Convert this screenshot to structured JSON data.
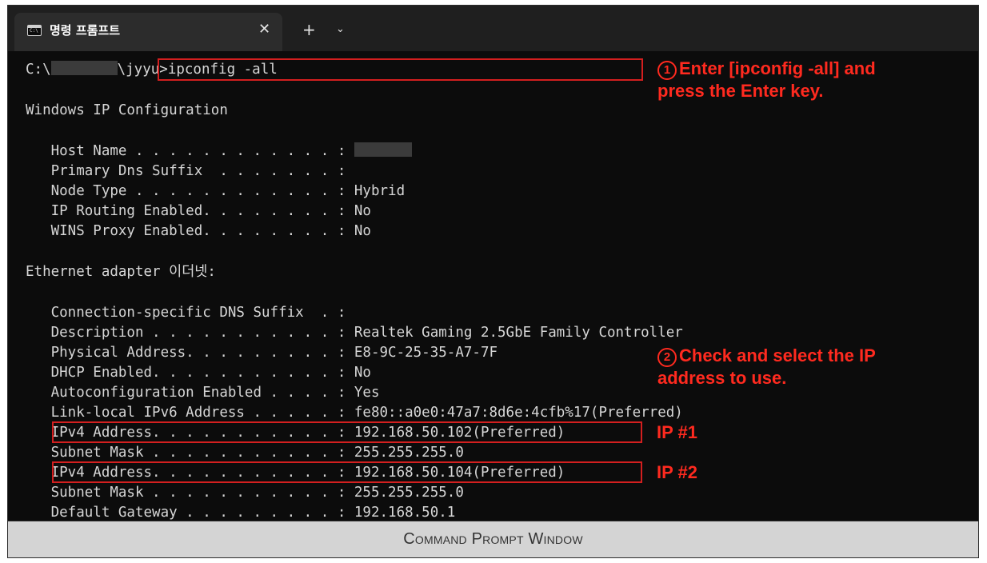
{
  "window": {
    "tab_title": "명령 프롬프트",
    "tab_icon_text": "C:\\",
    "close_glyph": "✕",
    "new_tab_glyph": "+",
    "dropdown_glyph": "⌄"
  },
  "console": {
    "prompt_prefix": "C:\\",
    "prompt_user": "\\jyyu>",
    "command": "ipconfig -all",
    "lines": [
      "Windows IP Configuration",
      "   Host Name . . . . . . . . . . . . : ",
      "   Primary Dns Suffix  . . . . . . . :",
      "   Node Type . . . . . . . . . . . . : Hybrid",
      "   IP Routing Enabled. . . . . . . . : No",
      "   WINS Proxy Enabled. . . . . . . . : No",
      "Ethernet adapter 이더넷:",
      "   Connection-specific DNS Suffix  . :",
      "   Description . . . . . . . . . . . : Realtek Gaming 2.5GbE Family Controller",
      "   Physical Address. . . . . . . . . : E8-9C-25-35-A7-7F",
      "   DHCP Enabled. . . . . . . . . . . : No",
      "   Autoconfiguration Enabled . . . . : Yes",
      "   Link-local IPv6 Address . . . . . : fe80::a0e0:47a7:8d6e:4cfb%17(Preferred)",
      "   IPv4 Address. . . . . . . . . . . : 192.168.50.102(Preferred)",
      "   Subnet Mask . . . . . . . . . . . : 255.255.255.0",
      "   IPv4 Address. . . . . . . . . . . : 192.168.50.104(Preferred)",
      "   Subnet Mask . . . . . . . . . . . : 255.255.255.0",
      "   Default Gateway . . . . . . . . . : 192.168.50.1"
    ]
  },
  "annotations": {
    "step1_num": "1",
    "step1_text": "Enter [ipconfig -all] and\npress the Enter key.",
    "step2_num": "2",
    "step2_text": "Check and select the IP\naddress to use.",
    "ip1": "IP #1",
    "ip2": "IP #2"
  },
  "caption": "Command Prompt Window",
  "colors": {
    "console_bg": "#0c0c0c",
    "console_text": "#d6d6d6",
    "highlight_red": "#d31f1f",
    "annotation_red": "#ff2a1f",
    "caption_bg": "#d4d4d4"
  }
}
